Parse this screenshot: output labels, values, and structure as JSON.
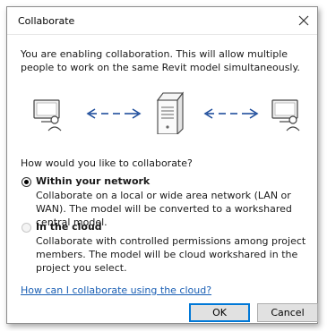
{
  "window": {
    "title": "Collaborate"
  },
  "intro": "You are enabling collaboration. This will allow multiple people to work on the same Revit model simultaneously.",
  "illustration": {
    "icons": [
      "user-workstation-icon",
      "double-arrow-icon",
      "server-icon",
      "double-arrow-icon",
      "user-workstation-icon"
    ]
  },
  "question": "How would you like to collaborate?",
  "options": [
    {
      "label": "Within your network",
      "description": "Collaborate on a local or wide area network (LAN or WAN). The model will be converted to a workshared central model.",
      "selected": true
    },
    {
      "label": "In the cloud",
      "description": "Collaborate with controlled permissions among project members. The model will be cloud workshared in the project you select.",
      "selected": false
    }
  ],
  "help_link": "How can I collaborate using the cloud?",
  "buttons": {
    "ok": "OK",
    "cancel": "Cancel"
  },
  "colors": {
    "link": "#1a5fb4",
    "arrow": "#1f4e9c",
    "accent": "#0078d7"
  }
}
